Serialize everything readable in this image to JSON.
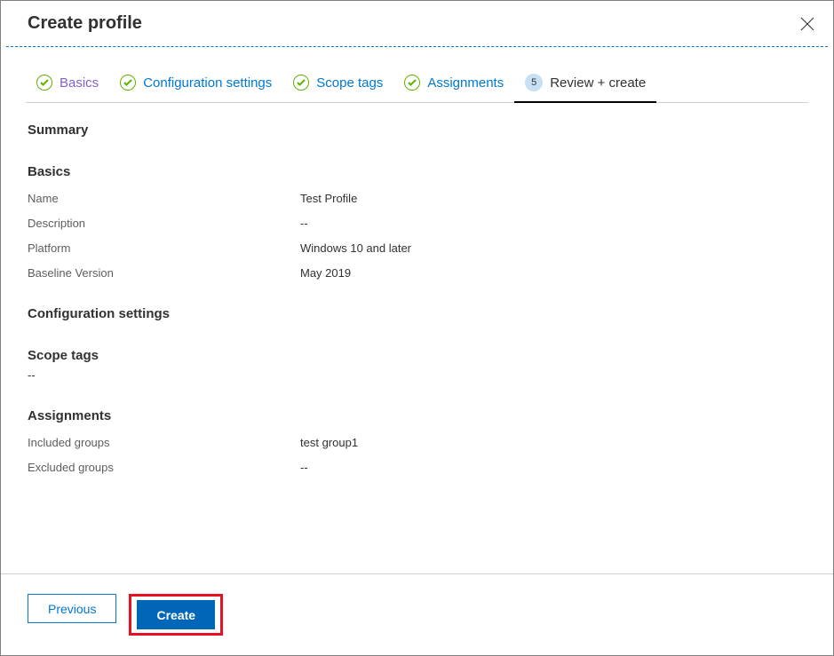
{
  "header": {
    "title": "Create profile"
  },
  "tabs": [
    {
      "label": "Basics",
      "state": "completed"
    },
    {
      "label": "Configuration settings",
      "state": "completed"
    },
    {
      "label": "Scope tags",
      "state": "completed"
    },
    {
      "label": "Assignments",
      "state": "completed"
    },
    {
      "label": "Review + create",
      "state": "active",
      "number": "5"
    }
  ],
  "summary": {
    "heading": "Summary",
    "basics": {
      "heading": "Basics",
      "rows": [
        {
          "key": "Name",
          "val": "Test Profile"
        },
        {
          "key": "Description",
          "val": "--"
        },
        {
          "key": "Platform",
          "val": "Windows 10 and later"
        },
        {
          "key": "Baseline Version",
          "val": "May 2019"
        }
      ]
    },
    "config": {
      "heading": "Configuration settings"
    },
    "scope": {
      "heading": "Scope tags",
      "value": "--"
    },
    "assign": {
      "heading": "Assignments",
      "rows": [
        {
          "key": "Included groups",
          "val": "test group1"
        },
        {
          "key": "Excluded groups",
          "val": "--"
        }
      ]
    }
  },
  "footer": {
    "previous": "Previous",
    "create": "Create"
  }
}
